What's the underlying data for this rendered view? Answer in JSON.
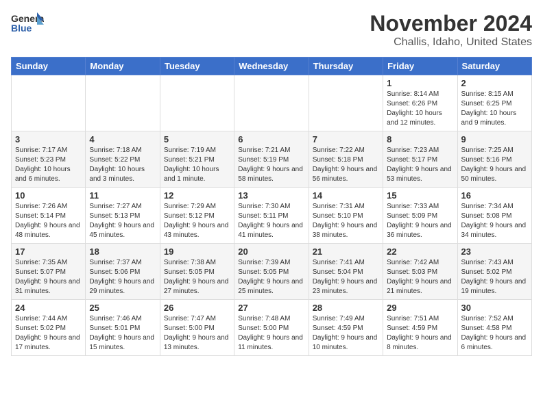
{
  "logo": {
    "general": "General",
    "blue": "Blue"
  },
  "title": "November 2024",
  "subtitle": "Challis, Idaho, United States",
  "weekdays": [
    "Sunday",
    "Monday",
    "Tuesday",
    "Wednesday",
    "Thursday",
    "Friday",
    "Saturday"
  ],
  "weeks": [
    [
      {
        "day": "",
        "info": ""
      },
      {
        "day": "",
        "info": ""
      },
      {
        "day": "",
        "info": ""
      },
      {
        "day": "",
        "info": ""
      },
      {
        "day": "",
        "info": ""
      },
      {
        "day": "1",
        "info": "Sunrise: 8:14 AM\nSunset: 6:26 PM\nDaylight: 10 hours and 12 minutes."
      },
      {
        "day": "2",
        "info": "Sunrise: 8:15 AM\nSunset: 6:25 PM\nDaylight: 10 hours and 9 minutes."
      }
    ],
    [
      {
        "day": "3",
        "info": "Sunrise: 7:17 AM\nSunset: 5:23 PM\nDaylight: 10 hours and 6 minutes."
      },
      {
        "day": "4",
        "info": "Sunrise: 7:18 AM\nSunset: 5:22 PM\nDaylight: 10 hours and 3 minutes."
      },
      {
        "day": "5",
        "info": "Sunrise: 7:19 AM\nSunset: 5:21 PM\nDaylight: 10 hours and 1 minute."
      },
      {
        "day": "6",
        "info": "Sunrise: 7:21 AM\nSunset: 5:19 PM\nDaylight: 9 hours and 58 minutes."
      },
      {
        "day": "7",
        "info": "Sunrise: 7:22 AM\nSunset: 5:18 PM\nDaylight: 9 hours and 56 minutes."
      },
      {
        "day": "8",
        "info": "Sunrise: 7:23 AM\nSunset: 5:17 PM\nDaylight: 9 hours and 53 minutes."
      },
      {
        "day": "9",
        "info": "Sunrise: 7:25 AM\nSunset: 5:16 PM\nDaylight: 9 hours and 50 minutes."
      }
    ],
    [
      {
        "day": "10",
        "info": "Sunrise: 7:26 AM\nSunset: 5:14 PM\nDaylight: 9 hours and 48 minutes."
      },
      {
        "day": "11",
        "info": "Sunrise: 7:27 AM\nSunset: 5:13 PM\nDaylight: 9 hours and 45 minutes."
      },
      {
        "day": "12",
        "info": "Sunrise: 7:29 AM\nSunset: 5:12 PM\nDaylight: 9 hours and 43 minutes."
      },
      {
        "day": "13",
        "info": "Sunrise: 7:30 AM\nSunset: 5:11 PM\nDaylight: 9 hours and 41 minutes."
      },
      {
        "day": "14",
        "info": "Sunrise: 7:31 AM\nSunset: 5:10 PM\nDaylight: 9 hours and 38 minutes."
      },
      {
        "day": "15",
        "info": "Sunrise: 7:33 AM\nSunset: 5:09 PM\nDaylight: 9 hours and 36 minutes."
      },
      {
        "day": "16",
        "info": "Sunrise: 7:34 AM\nSunset: 5:08 PM\nDaylight: 9 hours and 34 minutes."
      }
    ],
    [
      {
        "day": "17",
        "info": "Sunrise: 7:35 AM\nSunset: 5:07 PM\nDaylight: 9 hours and 31 minutes."
      },
      {
        "day": "18",
        "info": "Sunrise: 7:37 AM\nSunset: 5:06 PM\nDaylight: 9 hours and 29 minutes."
      },
      {
        "day": "19",
        "info": "Sunrise: 7:38 AM\nSunset: 5:05 PM\nDaylight: 9 hours and 27 minutes."
      },
      {
        "day": "20",
        "info": "Sunrise: 7:39 AM\nSunset: 5:05 PM\nDaylight: 9 hours and 25 minutes."
      },
      {
        "day": "21",
        "info": "Sunrise: 7:41 AM\nSunset: 5:04 PM\nDaylight: 9 hours and 23 minutes."
      },
      {
        "day": "22",
        "info": "Sunrise: 7:42 AM\nSunset: 5:03 PM\nDaylight: 9 hours and 21 minutes."
      },
      {
        "day": "23",
        "info": "Sunrise: 7:43 AM\nSunset: 5:02 PM\nDaylight: 9 hours and 19 minutes."
      }
    ],
    [
      {
        "day": "24",
        "info": "Sunrise: 7:44 AM\nSunset: 5:02 PM\nDaylight: 9 hours and 17 minutes."
      },
      {
        "day": "25",
        "info": "Sunrise: 7:46 AM\nSunset: 5:01 PM\nDaylight: 9 hours and 15 minutes."
      },
      {
        "day": "26",
        "info": "Sunrise: 7:47 AM\nSunset: 5:00 PM\nDaylight: 9 hours and 13 minutes."
      },
      {
        "day": "27",
        "info": "Sunrise: 7:48 AM\nSunset: 5:00 PM\nDaylight: 9 hours and 11 minutes."
      },
      {
        "day": "28",
        "info": "Sunrise: 7:49 AM\nSunset: 4:59 PM\nDaylight: 9 hours and 10 minutes."
      },
      {
        "day": "29",
        "info": "Sunrise: 7:51 AM\nSunset: 4:59 PM\nDaylight: 9 hours and 8 minutes."
      },
      {
        "day": "30",
        "info": "Sunrise: 7:52 AM\nSunset: 4:58 PM\nDaylight: 9 hours and 6 minutes."
      }
    ]
  ]
}
